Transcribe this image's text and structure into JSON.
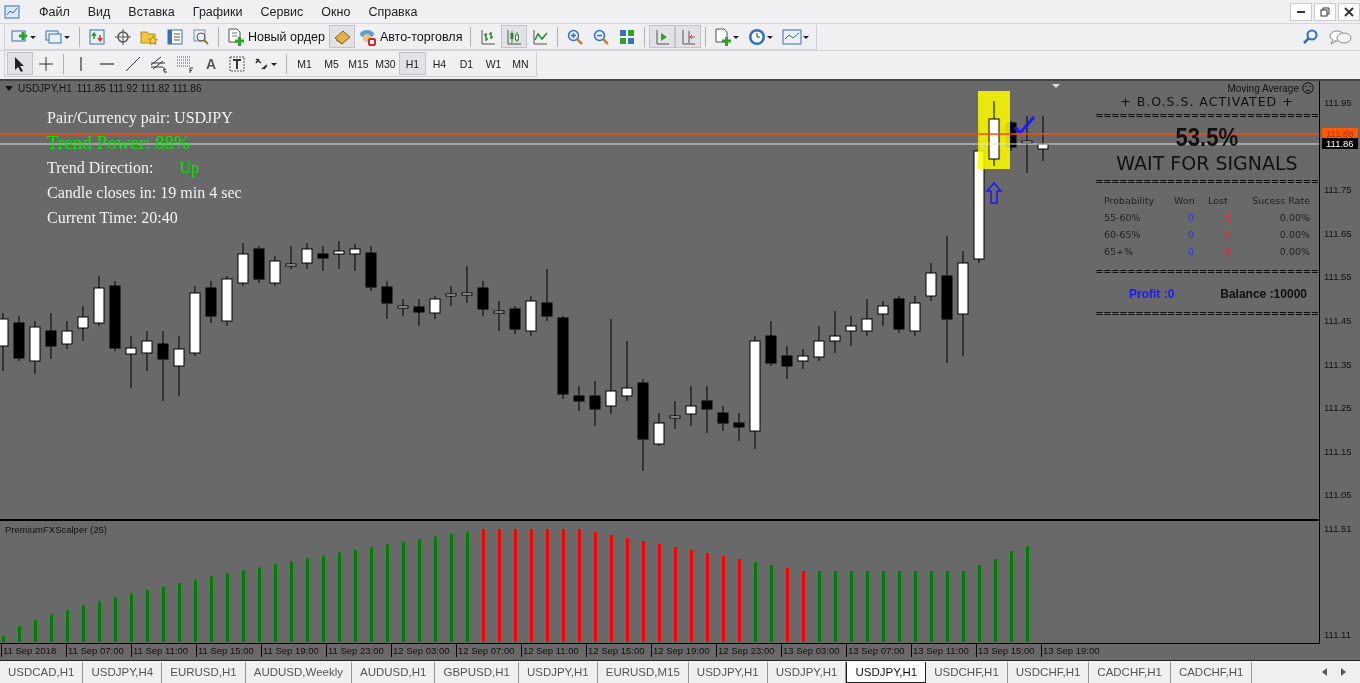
{
  "menu": [
    "Файл",
    "Вид",
    "Вставка",
    "Графики",
    "Сервис",
    "Окно",
    "Справка"
  ],
  "toolbar": {
    "new_order": "Новый ордер",
    "auto_trading": "Авто-торговля",
    "chart_types": [
      {
        "selected": false
      },
      {
        "selected": true
      },
      {
        "selected": false
      }
    ],
    "auto_scroll": {
      "pressed": true
    },
    "chart_shift": {
      "pressed": true
    }
  },
  "drawing_tools": {
    "cursor": {
      "selected": true
    },
    "crosshair": {
      "selected": false
    },
    "text_label": "A"
  },
  "timeframes": [
    {
      "label": "M1",
      "selected": false
    },
    {
      "label": "M5",
      "selected": false
    },
    {
      "label": "M15",
      "selected": false
    },
    {
      "label": "M30",
      "selected": false
    },
    {
      "label": "H1",
      "selected": true
    },
    {
      "label": "H4",
      "selected": false
    },
    {
      "label": "D1",
      "selected": false
    },
    {
      "label": "W1",
      "selected": false
    },
    {
      "label": "MN",
      "selected": false
    }
  ],
  "chart": {
    "header": {
      "symbol": "USDJPY,H1",
      "prices": "111.85 111.92 111.82 111.86"
    },
    "info": [
      {
        "kind": "plain",
        "text": "Pair/Currency pair: USDJPY"
      },
      {
        "kind": "highlight",
        "text": "Trend Power: 88%"
      },
      {
        "kind": "direction",
        "text": "Trend Direction:",
        "value": "Up"
      },
      {
        "kind": "plain",
        "text": "Candle closes in: 19 min 4 sec"
      },
      {
        "kind": "plain",
        "text": "Current Time: 20:40"
      }
    ]
  },
  "boss_panel": {
    "indicator_label": "Moving Average",
    "title": "+ B.O.S.S. ACTIVATED +",
    "separators": [
      "============================",
      "============================",
      "============================",
      "============================"
    ],
    "percent": "53.5%",
    "status": "WAIT FOR SIGNALS",
    "columns": [
      "Probability",
      "Won",
      "Lost",
      "Sucess Rate"
    ],
    "rows": [
      {
        "range": "55-60%",
        "won": "0",
        "lost": "0",
        "rate": "0.00%"
      },
      {
        "range": "60-65%",
        "won": "0",
        "lost": "0",
        "rate": "0.00%"
      },
      {
        "range": "65+%",
        "won": "0",
        "lost": "0",
        "rate": "0.00%"
      }
    ],
    "profit": "Profit :0",
    "balance": "Balance :10000"
  },
  "price_axis": {
    "labels": [
      "111.95",
      "111.75",
      "111.65",
      "111.55",
      "111.45",
      "111.35",
      "111.25",
      "111.15",
      "111.05"
    ],
    "ask": "111.88",
    "bid": "111.86"
  },
  "indicator": {
    "title": "PremiumFXScalper (25)",
    "axis_labels": [
      "111.51",
      "111.11"
    ]
  },
  "time_axis": [
    "11 Sep 2018",
    "11 Sep 07:00",
    "11 Sep 11:00",
    "11 Sep 15:00",
    "11 Sep 19:00",
    "11 Sep 23:00",
    "12 Sep 03:00",
    "12 Sep 07:00",
    "12 Sep 11:00",
    "12 Sep 15:00",
    "12 Sep 19:00",
    "12 Sep 23:00",
    "13 Sep 03:00",
    "13 Sep 07:00",
    "13 Sep 11:00",
    "13 Sep 15:00",
    "13 Sep 19:00"
  ],
  "tabs": [
    {
      "label": "USDCAD,H1",
      "selected": false
    },
    {
      "label": "USDJPY,H4",
      "selected": false
    },
    {
      "label": "EURUSD,H1",
      "selected": false
    },
    {
      "label": "AUDUSD,Weekly",
      "selected": false
    },
    {
      "label": "AUDUSD,H1",
      "selected": false
    },
    {
      "label": "GBPUSD,H1",
      "selected": false
    },
    {
      "label": "USDJPY,H1",
      "selected": false
    },
    {
      "label": "EURUSD,M15",
      "selected": false
    },
    {
      "label": "USDJPY,H1",
      "selected": false
    },
    {
      "label": "USDJPY,H1",
      "selected": false
    },
    {
      "label": "USDJPY,H1",
      "selected": true
    },
    {
      "label": "USDCHF,H1",
      "selected": false
    },
    {
      "label": "USDCHF,H1",
      "selected": false
    },
    {
      "label": "CADCHF,H1",
      "selected": false
    },
    {
      "label": "CADCHF,H1",
      "selected": false
    }
  ]
}
